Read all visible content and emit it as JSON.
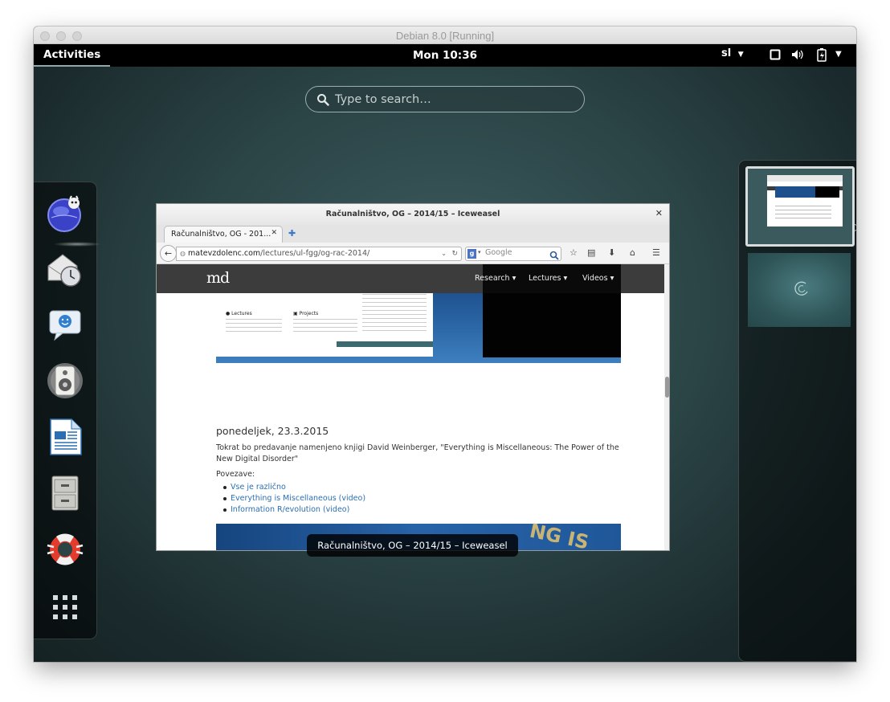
{
  "host_window": {
    "title": "Debian 8.0 [Running]"
  },
  "top_bar": {
    "activities": "Activities",
    "clock": "Mon 10:36",
    "keyboard_layout": "sl"
  },
  "search": {
    "placeholder": "Type to search…"
  },
  "dash": {
    "apps": [
      {
        "icon": "iceweasel-browser-icon",
        "running": true
      },
      {
        "icon": "evolution-mail-icon"
      },
      {
        "icon": "empathy-chat-icon"
      },
      {
        "icon": "rhythmbox-music-icon"
      },
      {
        "icon": "libreoffice-writer-icon"
      },
      {
        "icon": "files-cabinet-icon"
      },
      {
        "icon": "help-lifebuoy-icon"
      },
      {
        "icon": "show-applications-grid-icon"
      }
    ]
  },
  "window": {
    "title": "Računalništvo, OG – 2014/15 – Iceweasel",
    "tooltip": "Računalništvo, OG – 2014/15 – Iceweasel",
    "tab_label": "Računalništvo, OG - 201...",
    "url_host": "matevzdolenc.com",
    "url_path": "/lectures/ul-fgg/og-rac-2014/",
    "search_engine_placeholder": "Google"
  },
  "site": {
    "logo": "md",
    "menu": [
      "Research",
      "Lectures",
      "Videos"
    ],
    "preview": {
      "lectures_heading": "Lectures",
      "projects_heading": "Projects"
    }
  },
  "post": {
    "date": "ponedeljek, 23.3.2015",
    "text": "Tokrat bo predavanje namenjeno knjigi David Weinberger, \"Everything is Miscellaneous: The Power of the New Digital Disorder\"",
    "links_label": "Povezave:",
    "links": [
      "Vse je različno",
      "Everything is Miscellaneous (video)",
      "Information R/evolution (video)"
    ],
    "banner_text": "NG IS"
  },
  "colors": {
    "topbar": "#000000",
    "link": "#2a6fb4",
    "site_nav": "#3c3c3c"
  }
}
